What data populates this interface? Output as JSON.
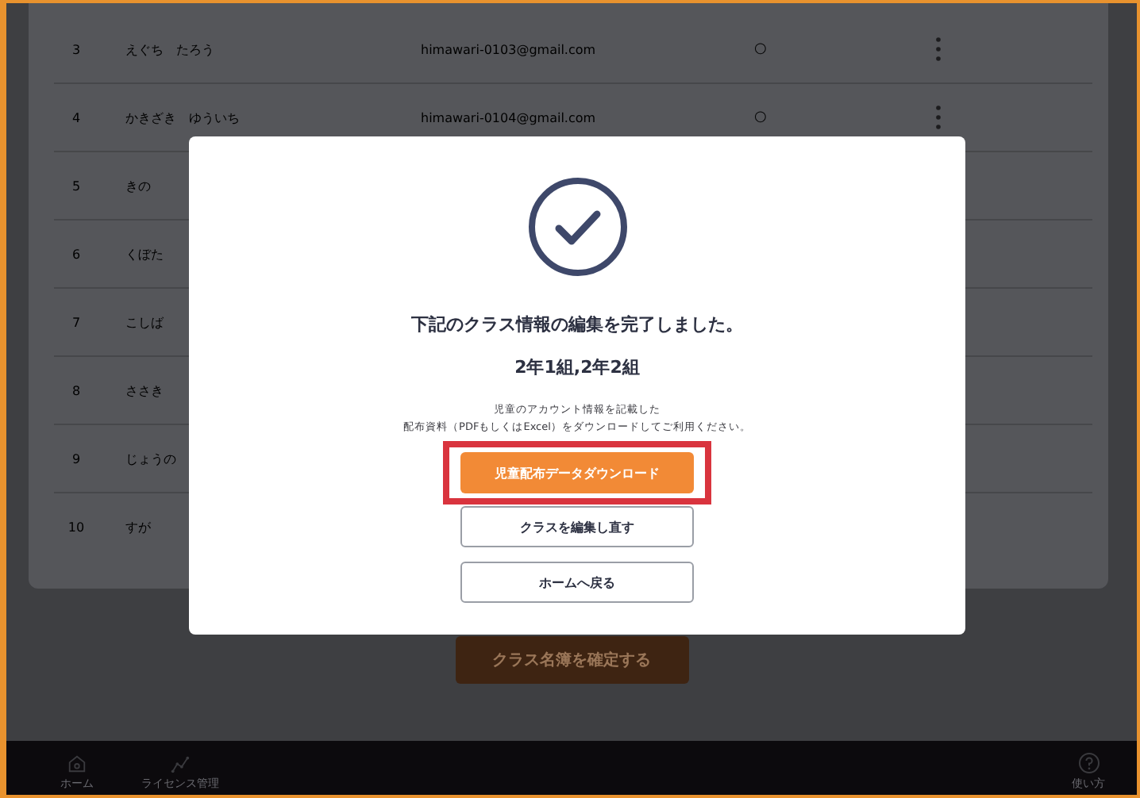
{
  "students": [
    {
      "number": "3",
      "name": "えぐち　たろう",
      "email": "himawari-0103@gmail.com",
      "status": "○"
    },
    {
      "number": "4",
      "name": "かきざき　ゆういち",
      "email": "himawari-0104@gmail.com",
      "status": "○"
    },
    {
      "number": "5",
      "name": "きの"
    },
    {
      "number": "6",
      "name": "くぼた"
    },
    {
      "number": "7",
      "name": "こしば"
    },
    {
      "number": "8",
      "name": "ささき"
    },
    {
      "number": "9",
      "name": "じょうの"
    },
    {
      "number": "10",
      "name": "すが"
    }
  ],
  "confirm_button": "クラス名簿を確定する",
  "dialog": {
    "title": "下記のクラス情報の編集を完了しました。",
    "classes": "2年1組,2年2組",
    "description": [
      "児童のアカウント情報を記載した",
      "配布資料（PDFもしくはExcel）をダウンロードしてご利用ください。"
    ],
    "buttons": [
      {
        "label": "児童配布データダウンロード",
        "kind": "primary",
        "highlighted": true
      },
      {
        "label": "クラスを編集し直す",
        "kind": "secondary",
        "highlighted": false
      },
      {
        "label": "ホームへ戻る",
        "kind": "secondary",
        "highlighted": false
      }
    ]
  },
  "bottom_nav": {
    "items": [
      {
        "label": "ホーム",
        "kind": "home"
      },
      {
        "label": "ライセンス管理",
        "kind": "license"
      }
    ],
    "help": {
      "label": "使い方"
    }
  }
}
